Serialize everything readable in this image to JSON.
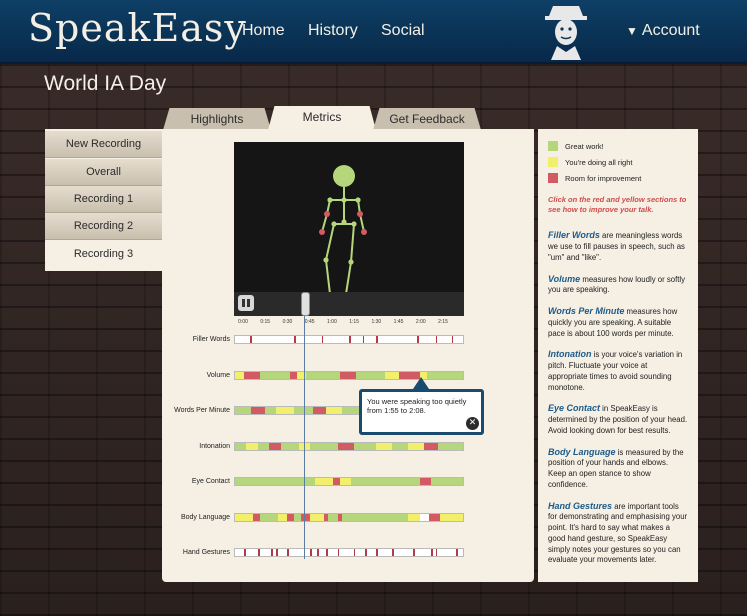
{
  "header": {
    "logo": "SpeakEasy",
    "nav": [
      "Home",
      "History",
      "Social"
    ],
    "account_label": "Account",
    "account_caret": "▼"
  },
  "page_title": "World IA Day",
  "tabs": [
    "Highlights",
    "Metrics",
    "Get Feedback"
  ],
  "active_tab": "Metrics",
  "sidebar": {
    "items": [
      "New Recording",
      "Overall",
      "Recording 1",
      "Recording 2",
      "Recording 3"
    ],
    "active": "Recording 3"
  },
  "video": {
    "ticks": [
      "0:00",
      "0:15",
      "0:30",
      "0:45",
      "1:00",
      "1:15",
      "1:30",
      "1:45",
      "2:00",
      "2:15"
    ],
    "playhead_fraction": 0.305
  },
  "colors": {
    "great": "#b5d67a",
    "ok": "#f2ef6a",
    "improve": "#d25a63",
    "tick_red": "#b43a48"
  },
  "metrics": [
    {
      "label": "Filler Words"
    },
    {
      "label": "Volume"
    },
    {
      "label": "Words Per Minute"
    },
    {
      "label": "Intonation"
    },
    {
      "label": "Eye Contact"
    },
    {
      "label": "Body Language"
    },
    {
      "label": "Hand Gestures"
    }
  ],
  "tooltip": {
    "text": "You were speaking too quietly from 1:55 to 2:08.",
    "close_icon": "close-icon"
  },
  "legend": [
    {
      "label": "Great work!",
      "color": "#b5d67a"
    },
    {
      "label": "You're doing all right",
      "color": "#f2ef6a"
    },
    {
      "label": "Room for improvement",
      "color": "#d25a63"
    }
  ],
  "hint": "Click on the red and yellow sections to see how to improve your talk.",
  "descriptions": [
    {
      "term": "Filler Words",
      "text": " are meaningless words we use to fill pauses in speech, such as \"um\" and \"like\"."
    },
    {
      "term": "Volume",
      "text": " measures how loudly or softly you are speaking."
    },
    {
      "term": "Words Per Minute",
      "text": " measures how quickly you are speaking. A suitable pace is about 100 words per minute."
    },
    {
      "term": "Intonation",
      "text": " is your voice's variation in pitch. Fluctuate your voice at appropriate times to avoid sounding monotone."
    },
    {
      "term": "Eye Contact",
      "text": " in SpeakEasy is determined by the position of your head. Avoid looking down for best results."
    },
    {
      "term": "Body Language",
      "text": " is measured by the position of your hands and elbows. Keep an open stance to show confidence."
    },
    {
      "term": "Hand Gestures",
      "text": " are important tools for demonstrating and emphasising your point. It's hard to say what makes a good hand gesture, so SpeakEasy simply notes your gestures so you can evaluate your movements later."
    }
  ]
}
